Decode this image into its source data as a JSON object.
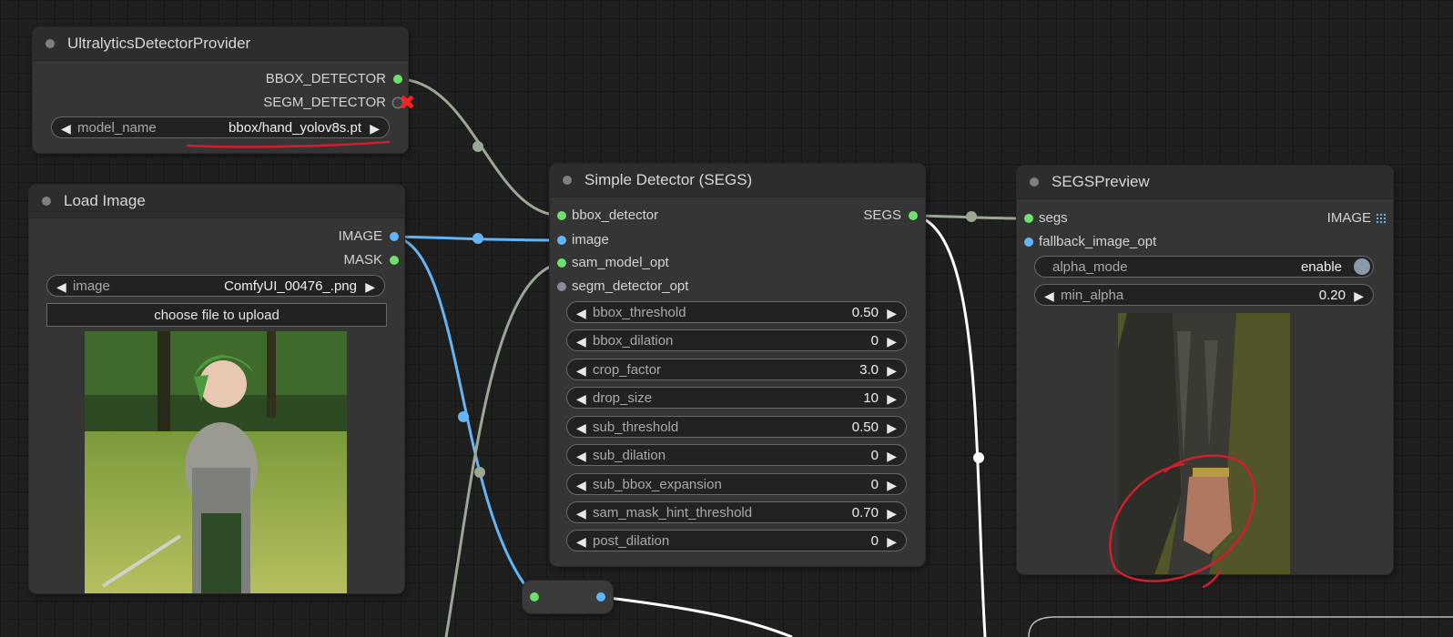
{
  "nodes": {
    "ultralytics": {
      "title": "UltralyticsDetectorProvider",
      "outputs": [
        "BBOX_DETECTOR",
        "SEGM_DETECTOR"
      ],
      "widgets": [
        {
          "label": "model_name",
          "value": "bbox/hand_yolov8s.pt"
        }
      ]
    },
    "load_image": {
      "title": "Load Image",
      "outputs": [
        "IMAGE",
        "MASK"
      ],
      "widgets": [
        {
          "label": "image",
          "value": "ComfyUI_00476_.png"
        }
      ],
      "upload_label": "choose file to upload"
    },
    "simple_detector": {
      "title": "Simple Detector (SEGS)",
      "inputs": [
        "bbox_detector",
        "image",
        "sam_model_opt",
        "segm_detector_opt"
      ],
      "outputs": [
        "SEGS"
      ],
      "widgets": [
        {
          "label": "bbox_threshold",
          "value": "0.50"
        },
        {
          "label": "bbox_dilation",
          "value": "0"
        },
        {
          "label": "crop_factor",
          "value": "3.0"
        },
        {
          "label": "drop_size",
          "value": "10"
        },
        {
          "label": "sub_threshold",
          "value": "0.50"
        },
        {
          "label": "sub_dilation",
          "value": "0"
        },
        {
          "label": "sub_bbox_expansion",
          "value": "0"
        },
        {
          "label": "sam_mask_hint_threshold",
          "value": "0.70"
        },
        {
          "label": "post_dilation",
          "value": "0"
        }
      ]
    },
    "segs_preview": {
      "title": "SEGSPreview",
      "inputs": [
        "segs",
        "fallback_image_opt"
      ],
      "outputs": [
        "IMAGE"
      ],
      "widgets": [
        {
          "label": "alpha_mode",
          "value": "enable"
        },
        {
          "label": "min_alpha",
          "value": "0.20"
        }
      ]
    }
  },
  "colors": {
    "canvas": "#1f1f1f",
    "node_body": "#353535",
    "node_title": "#2d2d2d",
    "link_detector": "#9aa894",
    "link_image": "#64b5f6",
    "link_segs_out": "#ffffff",
    "slot_green": "#6ee06e",
    "slot_blue": "#64b5f6",
    "annotation_red": "#d21e2d"
  }
}
